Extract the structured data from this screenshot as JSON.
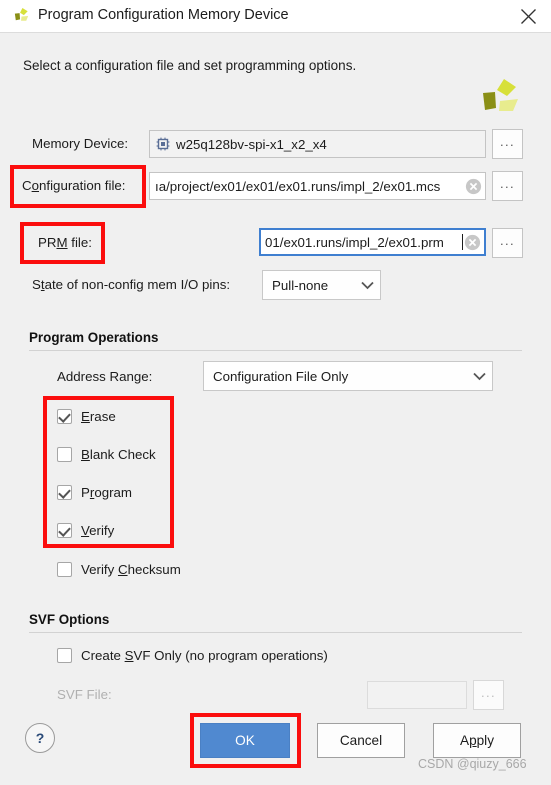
{
  "window": {
    "title": "Program Configuration Memory Device",
    "logo_icon": "vivado-logo-icon",
    "close_icon": "close-icon"
  },
  "header": {
    "instruction": "Select a configuration file and set programming options.",
    "logo_icon": "vivado-logo-icon"
  },
  "form": {
    "memory_device": {
      "label": "Memory Device:",
      "value": "w25q128bv-spi-x1_x2_x4",
      "icon": "memory-chip-icon",
      "browse_label": "..."
    },
    "configuration_file": {
      "label_prefix": "C",
      "label_accel": "o",
      "label_suffix": "nfiguration file:",
      "value": "ıa/project/ex01/ex01/ex01.runs/impl_2/ex01.mcs",
      "clear_icon": "clear-circle-icon",
      "browse_label": "..."
    },
    "prm_file": {
      "label_prefix": "PR",
      "label_accel": "M",
      "label_suffix": " file:",
      "value": "01/ex01.runs/impl_2/ex01.prm",
      "clear_icon": "clear-circle-icon",
      "browse_label": "..."
    },
    "non_config_pins": {
      "label_prefix": "S",
      "label_accel": "t",
      "label_suffix": "ate of non-config mem I/O pins:",
      "value": "Pull-none",
      "arrow_icon": "chevron-down-icon"
    }
  },
  "program_operations": {
    "title": "Program Operations",
    "address_range": {
      "label_prefix": "Address Ran",
      "label_accel": "g",
      "label_suffix": "e:",
      "value": "Configuration File Only",
      "arrow_icon": "chevron-down-icon"
    },
    "checkboxes": [
      {
        "prefix": "",
        "accel": "E",
        "suffix": "rase",
        "checked": true
      },
      {
        "prefix": "",
        "accel": "B",
        "suffix": "lank Check",
        "checked": false
      },
      {
        "prefix": "P",
        "accel": "r",
        "suffix": "ogram",
        "checked": true
      },
      {
        "prefix": "",
        "accel": "V",
        "suffix": "erify",
        "checked": true
      },
      {
        "prefix": "Verify ",
        "accel": "C",
        "suffix": "hecksum",
        "checked": false
      }
    ]
  },
  "svf_options": {
    "title": "SVF Options",
    "create_svf_only": {
      "prefix": "Create ",
      "accel": "S",
      "suffix": "VF Only (no program operations)",
      "checked": false
    },
    "svf_file": {
      "label": "SVF File:",
      "value": "",
      "browse_label": "..."
    }
  },
  "footer": {
    "help_label": "?",
    "ok_label": "OK",
    "cancel_label": "Cancel",
    "apply_prefix": "A",
    "apply_accel": "p",
    "apply_suffix": "ply"
  },
  "watermark": "CSDN @qiuzy_666",
  "colors": {
    "annotation": "#fb0d0d",
    "primary_button": "#5089d0",
    "focus_border": "#3f7fd0",
    "logo_bright": "#d7e03a",
    "logo_dark": "#8a8f16",
    "logo_pale": "#e8ec8e",
    "background": "#f0f0f0"
  }
}
